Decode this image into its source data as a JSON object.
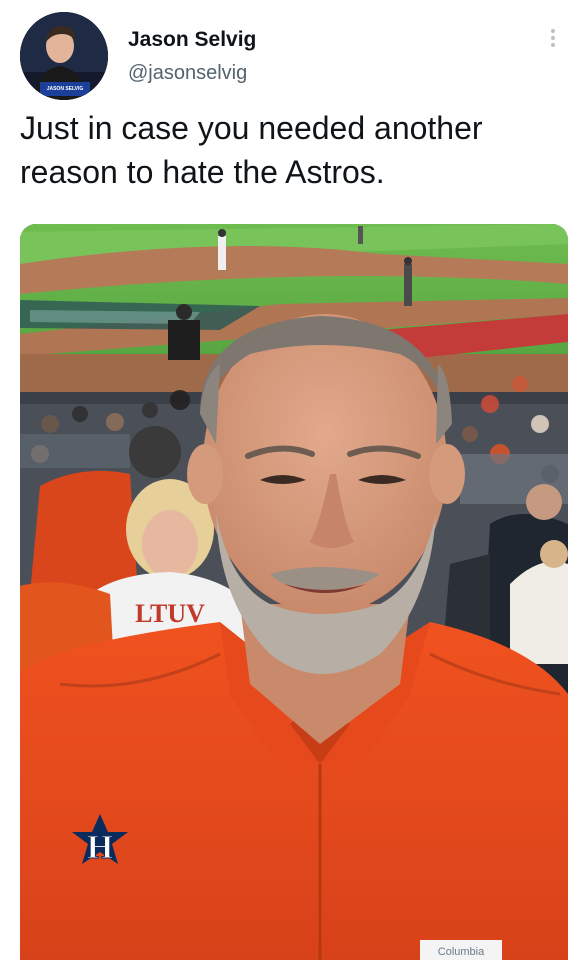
{
  "tweet": {
    "author_name": "Jason Selvig",
    "author_handle": "@jasonselvig",
    "text": "Just in case you needed another reason to hate the Astros.",
    "more_icon": "more-vertical-icon"
  },
  "avatar": {
    "caption": "JASON SELVIG"
  },
  "photo": {
    "jersey_lettering": "LTUV",
    "shirt_logo": "H",
    "pocket_label": "Columbia"
  },
  "colors": {
    "shirt_orange": "#ea4a1e",
    "field_green": "#5cae45",
    "dirt": "#b07553",
    "handle_gray": "#536471"
  }
}
